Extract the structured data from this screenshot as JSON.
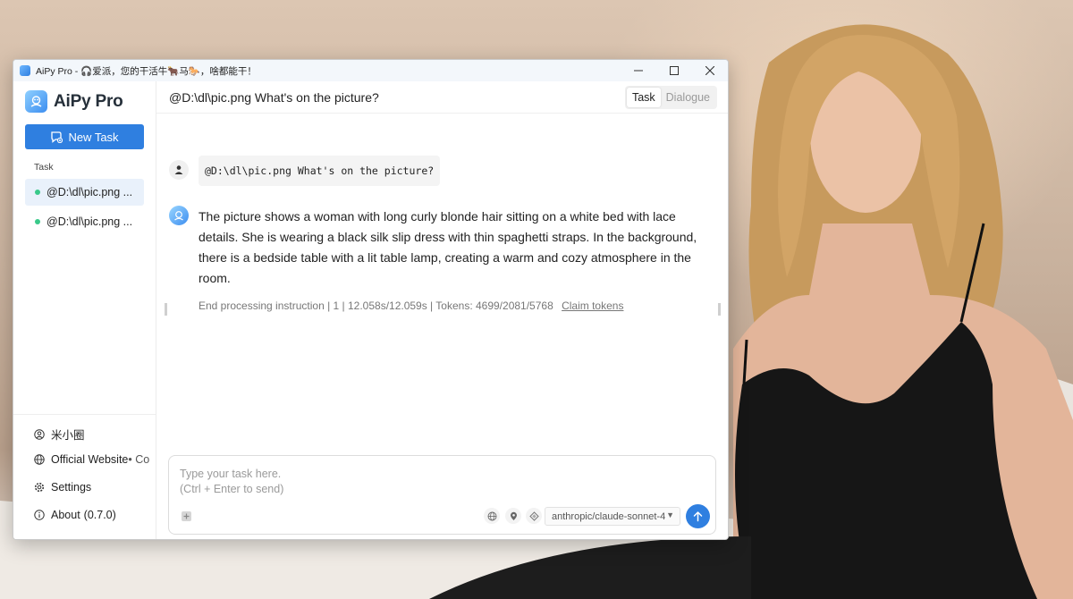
{
  "window": {
    "title": "AiPy Pro - 🎧爱派，您的干活牛🐂马🐎，啥都能干！",
    "minimize": "—",
    "maximize": "☐",
    "close": "✕"
  },
  "sidebar": {
    "brand": "AiPy Pro",
    "new_task_label": "New Task",
    "section_label": "Task",
    "tasks": [
      {
        "label": "@D:\\dl\\pic.png ...",
        "active": true
      },
      {
        "label": "@D:\\dl\\pic.png ...",
        "active": false
      }
    ],
    "links": {
      "community": "米小圈",
      "website": "Official Website",
      "website_suffix": " • Co",
      "settings": "Settings",
      "about": "About",
      "version": "(0.7.0)"
    }
  },
  "main": {
    "title": "@D:\\dl\\pic.png What's on the picture?",
    "modes": {
      "task": "Task",
      "dialogue": "Dialogue"
    },
    "user_message": "@D:\\dl\\pic.png What's on the picture?",
    "bot_message": "The picture shows a woman with long curly blonde hair sitting on a white bed with lace details. She is wearing a black silk slip dress with thin spaghetti straps. In the background, there is a bedside table with a lit table lamp, creating a warm and cozy atmosphere in the room.",
    "meta": "End processing instruction | 1 | 12.058s/12.059s | Tokens: 4699/2081/5768",
    "claim_tokens": "Claim tokens"
  },
  "composer": {
    "placeholder": "Type your task here.\n(Ctrl + Enter to send)",
    "model": "anthropic/claude-sonnet-4"
  },
  "colors": {
    "accent": "#2f7fe0",
    "active_dot": "#39c98a"
  }
}
